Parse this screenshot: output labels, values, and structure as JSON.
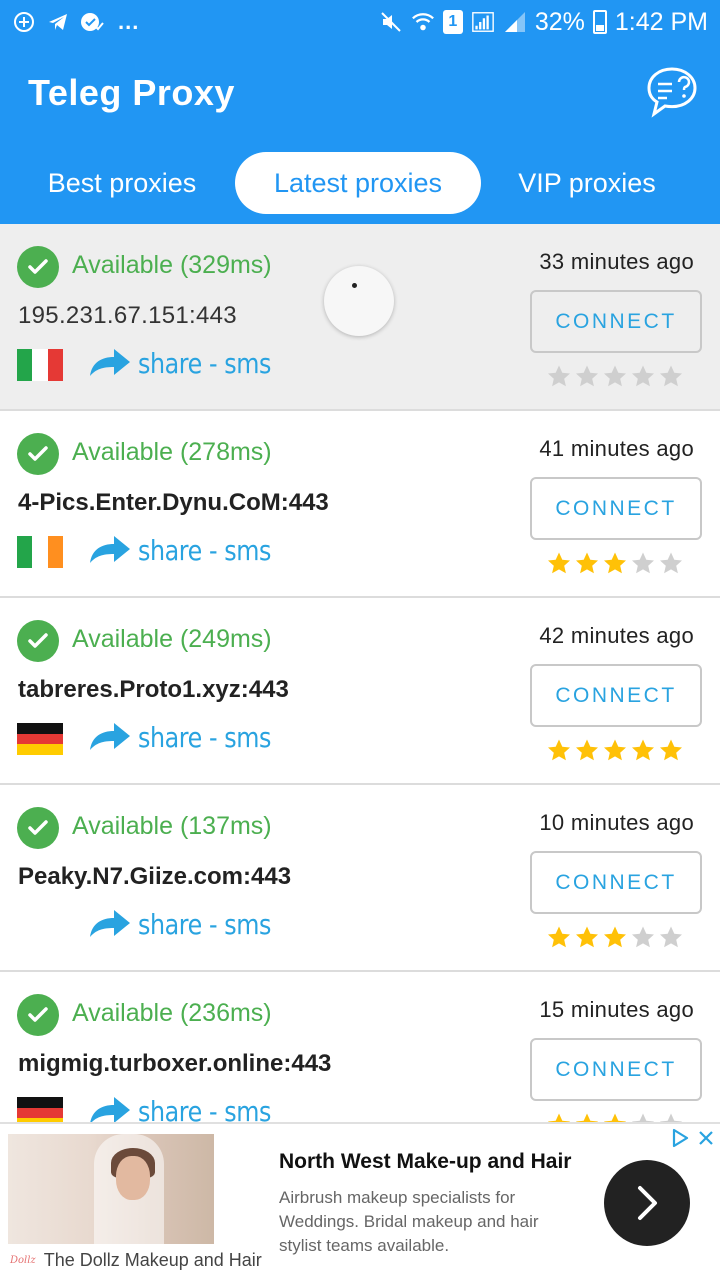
{
  "status_bar": {
    "more": "...",
    "battery": "32%",
    "clock": "1:42 PM",
    "sim": "1"
  },
  "app": {
    "title": "Teleg Proxy",
    "help_icon": "chat-question-icon"
  },
  "tabs": [
    {
      "label": "Best proxies",
      "selected": false
    },
    {
      "label": "Latest proxies",
      "selected": true
    },
    {
      "label": "VIP proxies",
      "selected": false
    }
  ],
  "proxies": [
    {
      "status": "Available (329ms)",
      "host": "195.231.67.151:443",
      "time": "33 minutes ago",
      "connect": "CONNECT",
      "share": "share - sms",
      "flag": "italy",
      "rating": 0
    },
    {
      "status": "Available (278ms)",
      "host": "4-Pics.Enter.Dynu.CoM:443",
      "time": "41 minutes ago",
      "connect": "CONNECT",
      "share": "share - sms",
      "flag": "ireland",
      "rating": 3
    },
    {
      "status": "Available (249ms)",
      "host": "tabreres.Proto1.xyz:443",
      "time": "42 minutes ago",
      "connect": "CONNECT",
      "share": "share - sms",
      "flag": "germany",
      "rating": 5
    },
    {
      "status": "Available (137ms)",
      "host": "Peaky.N7.Giize.com:443",
      "time": "10 minutes ago",
      "connect": "CONNECT",
      "share": "share - sms",
      "flag": "",
      "rating": 3
    },
    {
      "status": "Available (236ms)",
      "host": "migmig.turboxer.online:443",
      "time": "15 minutes ago",
      "connect": "CONNECT",
      "share": "share - sms",
      "flag": "germany",
      "rating": 3
    }
  ],
  "colors": {
    "primary": "#2196f3",
    "available": "#4caf50",
    "link": "#29a3e0",
    "star_on": "#ffc107",
    "star_off": "#cfcfcf"
  },
  "ad": {
    "title": "North West Make-up and Hair",
    "description": "Airbrush makeup specialists for Weddings. Bridal makeup and hair stylist teams available.",
    "advertiser": "The Dollz Makeup and Hair",
    "logo_text": "Dollz"
  }
}
